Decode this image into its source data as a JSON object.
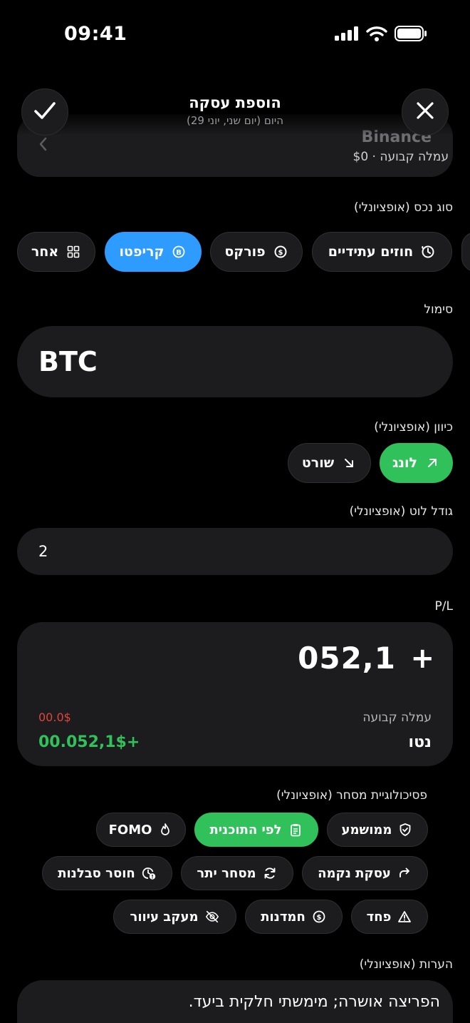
{
  "status_bar": {
    "time": "09:41"
  },
  "header": {
    "title": "הוספת עסקה",
    "subtitle": "היום (יום שני, יוני 29)"
  },
  "exchange": {
    "name": "Binance",
    "fee_label": "עמלה קבועה · $0"
  },
  "asset_type": {
    "label": "סוג נכס (אופציונלי)",
    "options": [
      {
        "label": "חוזים עתידיים",
        "icon": "clock-icon",
        "selected": false
      },
      {
        "label": "פורקס",
        "icon": "dollar-exchange-icon",
        "selected": false
      },
      {
        "label": "קריפטו",
        "icon": "bitcoin-icon",
        "selected": true
      },
      {
        "label": "אחר",
        "icon": "grid-icon",
        "selected": false
      }
    ]
  },
  "symbol": {
    "label": "סימול",
    "value": "BTC"
  },
  "direction": {
    "label": "כיוון (אופציונלי)",
    "long_label": "לונג",
    "short_label": "שורט",
    "selected": "long"
  },
  "lot_size": {
    "label": "גודל לוט (אופציונלי)",
    "value": "2"
  },
  "pl": {
    "label": "P/L",
    "sign": "+",
    "amount": "052,1",
    "fee_label": "עמלה קבועה",
    "fee_value": "00.0$",
    "net_label": "נטו",
    "net_value": "00.052,1$+",
    "colors": {
      "positive": "#30c15a",
      "negative": "#e0443a"
    }
  },
  "psychology": {
    "label": "פסיכולוגיית מסחר (אופציונלי)",
    "tags": [
      {
        "label": "ממושמע",
        "icon": "shield-check-icon",
        "selected": false
      },
      {
        "label": "לפי התוכנית",
        "icon": "clipboard-icon",
        "selected": true
      },
      {
        "label": "FOMO",
        "icon": "flame-icon",
        "selected": false
      },
      {
        "label": "עסקת נקמה",
        "icon": "redo-arrow-icon",
        "selected": false
      },
      {
        "label": "מסחר יתר",
        "icon": "refresh-icon",
        "selected": false
      },
      {
        "label": "חוסר סבלנות",
        "icon": "clock-alert-icon",
        "selected": false
      },
      {
        "label": "פחד",
        "icon": "warning-icon",
        "selected": false
      },
      {
        "label": "חמדנות",
        "icon": "coin-icon",
        "selected": false
      },
      {
        "label": "מעקב עיוור",
        "icon": "eye-off-icon",
        "selected": false
      }
    ]
  },
  "notes": {
    "label": "הערות (אופציונלי)",
    "value": "הפריצה אושרה; מימשתי חלקית ביעד."
  },
  "theme": {
    "accent_blue": "#2d9bff",
    "accent_green": "#30c15a",
    "surface": "#1c1c1e"
  }
}
